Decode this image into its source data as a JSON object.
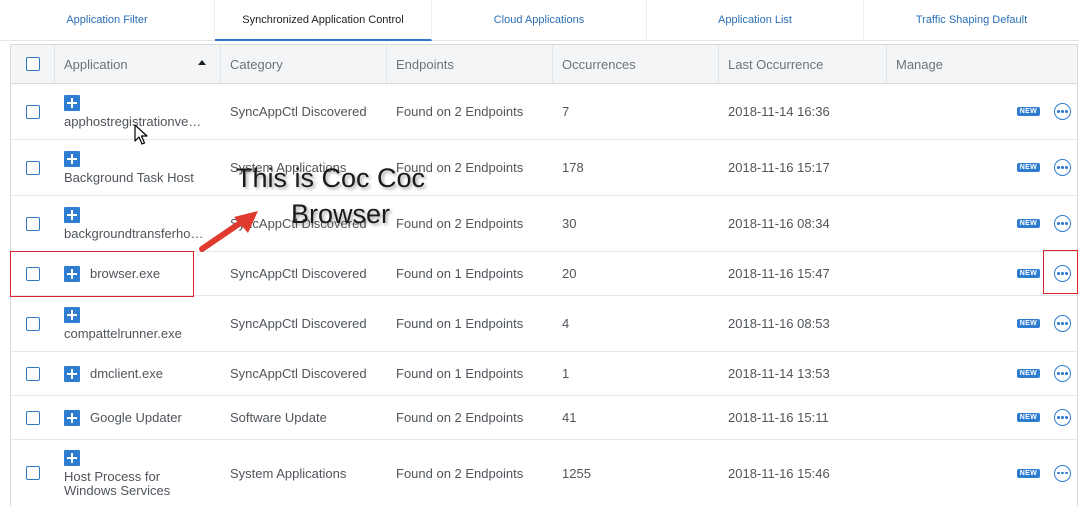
{
  "tabs": [
    {
      "label": "Application Filter"
    },
    {
      "label": "Synchronized Application Control"
    },
    {
      "label": "Cloud Applications"
    },
    {
      "label": "Application List"
    },
    {
      "label": "Traffic Shaping Default"
    }
  ],
  "table": {
    "headers": {
      "application": "Application",
      "category": "Category",
      "endpoints": "Endpoints",
      "occurrences": "Occurrences",
      "last_occurrence": "Last Occurrence",
      "manage": "Manage"
    },
    "sort": {
      "column": "application",
      "direction": "ascending"
    },
    "rows": [
      {
        "app": "apphostregistrationve…",
        "category": "SyncAppCtl Discovered",
        "endpoints": "Found on 2 Endpoints",
        "occurrences": "7",
        "last": "2018-11-14 16:36",
        "badge": "NEW"
      },
      {
        "app": "Background Task Host",
        "category": "System Applications",
        "endpoints": "Found on 2 Endpoints",
        "occurrences": "178",
        "last": "2018-11-16 15:17",
        "badge": "NEW"
      },
      {
        "app": "backgroundtransferho…",
        "category": "SyncAppCtl Discovered",
        "endpoints": "Found on 2 Endpoints",
        "occurrences": "30",
        "last": "2018-11-16 08:34",
        "badge": "NEW"
      },
      {
        "app": "browser.exe",
        "category": "SyncAppCtl Discovered",
        "endpoints": "Found on 1 Endpoints",
        "occurrences": "20",
        "last": "2018-11-16 15:47",
        "badge": "NEW"
      },
      {
        "app": "compattelrunner.exe",
        "category": "SyncAppCtl Discovered",
        "endpoints": "Found on 1 Endpoints",
        "occurrences": "4",
        "last": "2018-11-16 08:53",
        "badge": "NEW"
      },
      {
        "app": "dmclient.exe",
        "category": "SyncAppCtl Discovered",
        "endpoints": "Found on 1 Endpoints",
        "occurrences": "1",
        "last": "2018-11-14 13:53",
        "badge": "NEW"
      },
      {
        "app": "Google Updater",
        "category": "Software Update",
        "endpoints": "Found on 2 Endpoints",
        "occurrences": "41",
        "last": "2018-11-16 15:11",
        "badge": "NEW"
      },
      {
        "app_line1": "Host Process for",
        "app_line2": "Windows Services",
        "category": "System Applications",
        "endpoints": "Found on 2 Endpoints",
        "occurrences": "1255",
        "last": "2018-11-16 15:46",
        "badge": "NEW"
      }
    ]
  },
  "annotation": {
    "line1": "This is Coc Coc",
    "line2": "Browser",
    "color": "#d8242c"
  },
  "colors": {
    "accent": "#2f7dd1",
    "tab_link": "#2a6fb5",
    "header_bg": "#f4f5f7"
  },
  "icons": [
    "plus-square-icon",
    "more-options-icon",
    "checkbox",
    "sort-ascending-icon",
    "mouse-pointer-icon",
    "arrow-icon"
  ]
}
